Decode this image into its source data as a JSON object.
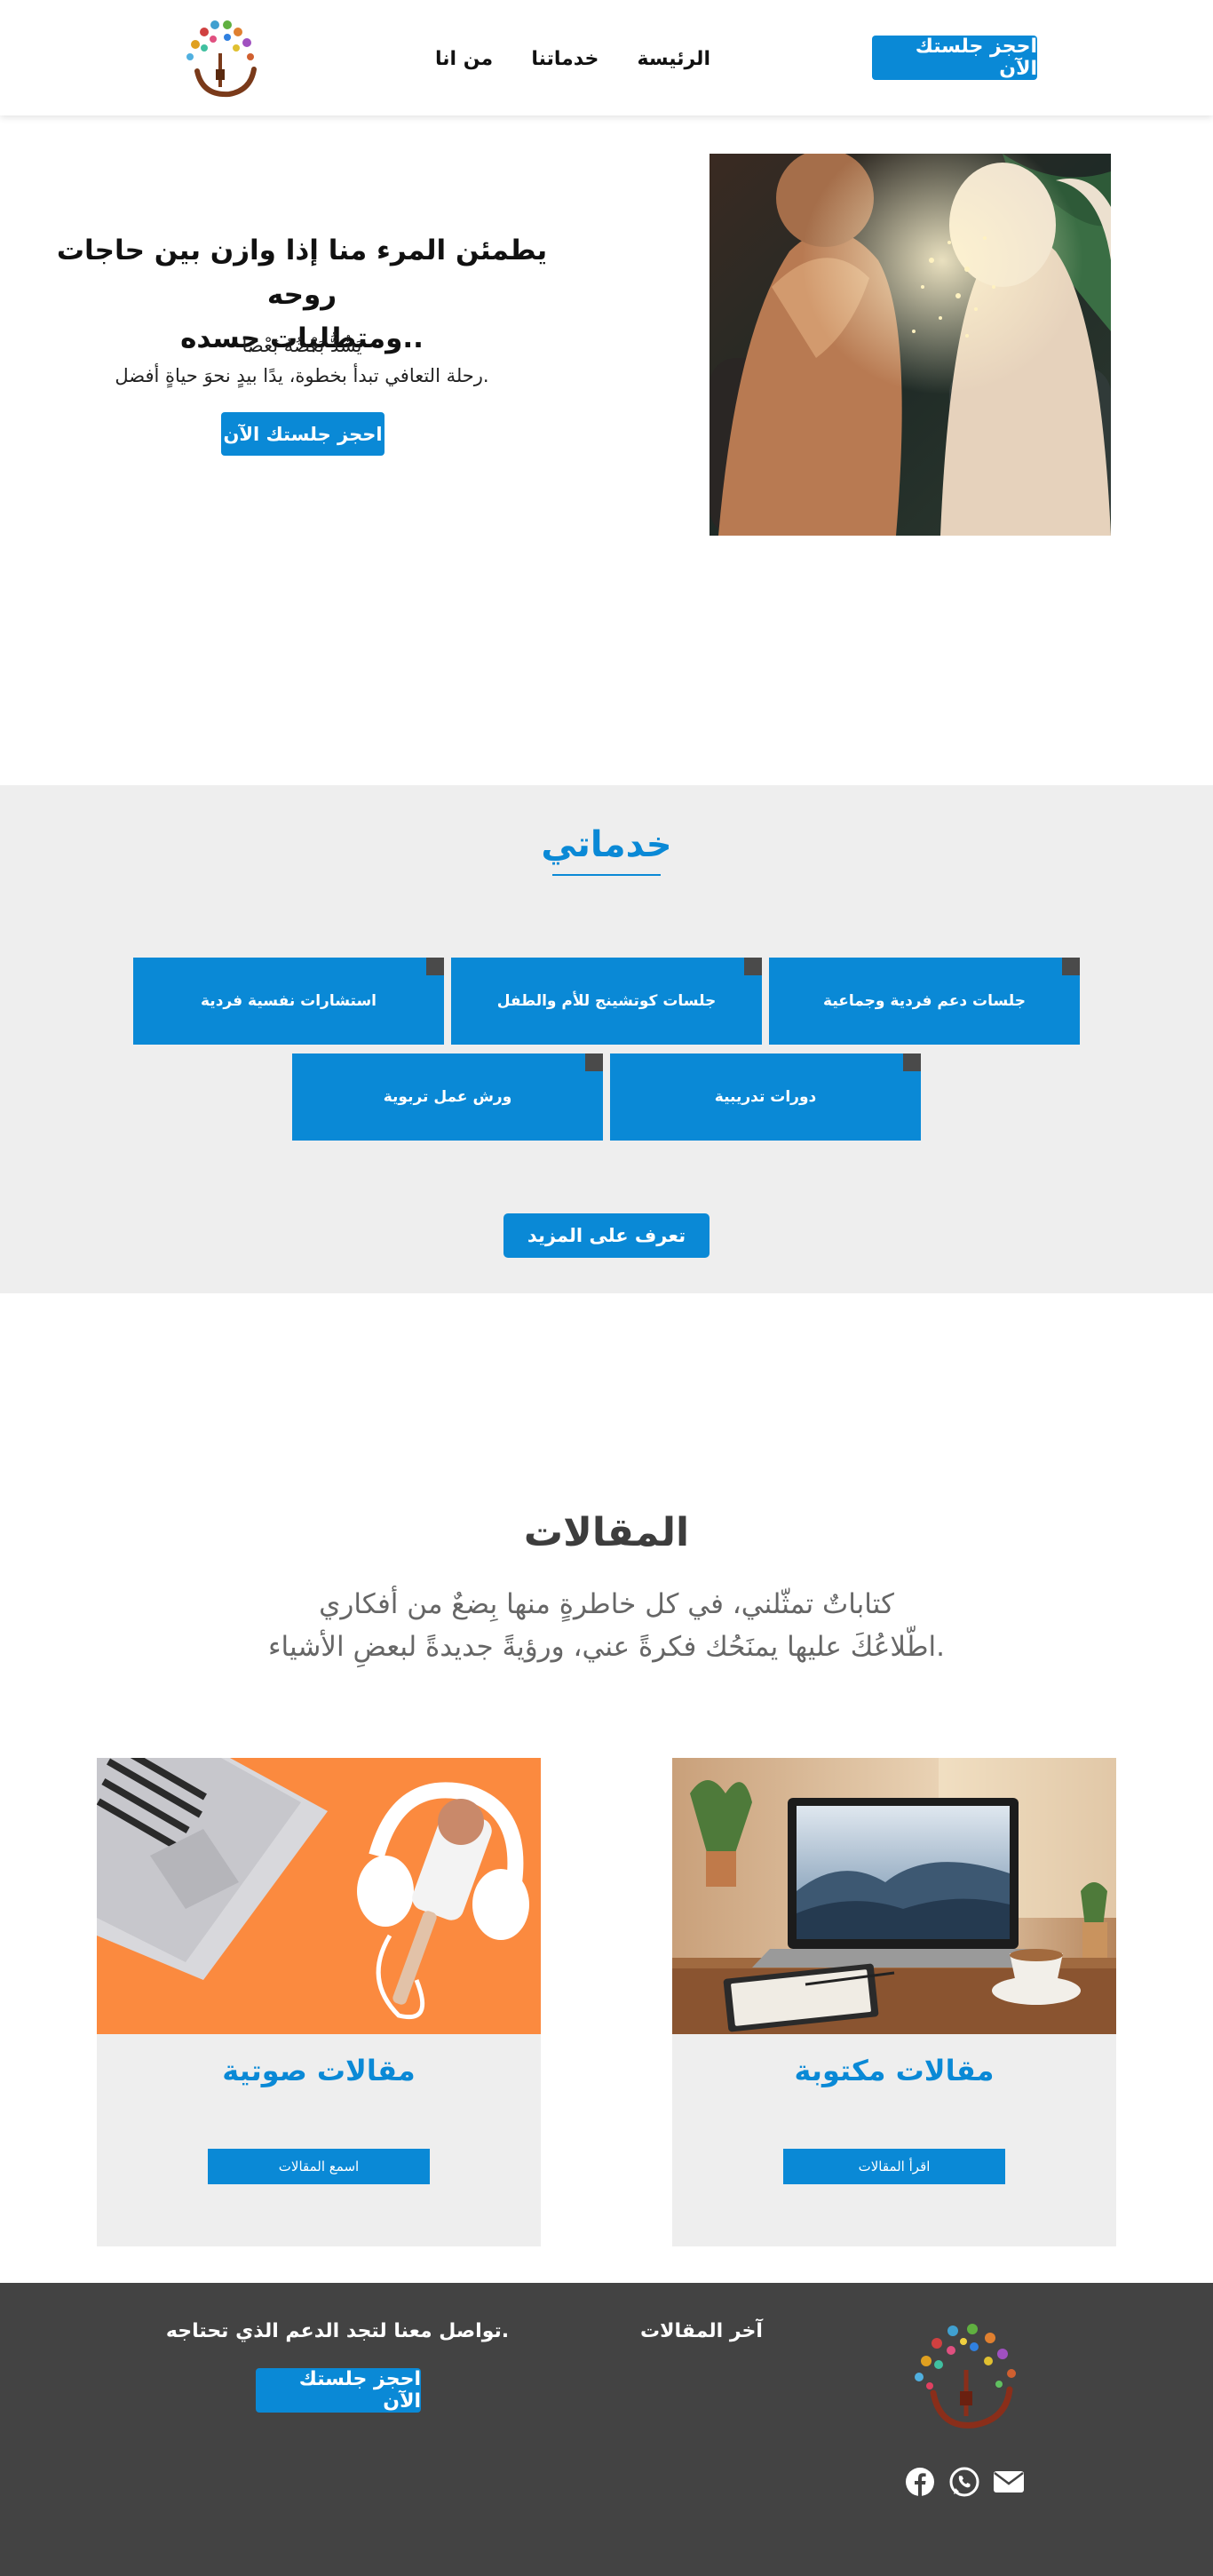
{
  "header": {
    "book_button": "احجز جلستك الآن",
    "nav": [
      "الرئيسة",
      "خدماتنا",
      "من انا"
    ],
    "logo_icon": "tree-logo"
  },
  "hero": {
    "title_line1": "يطمئن المرء منا إذا وازن بين حاجات روحه",
    "title_line2": "..ومتطلبات جسده",
    "subtitle_line1": "يَشُدُّ بَعْضُهُ بَعْضًا",
    "subtitle_line2": ".رحلة التعافي تبدأ بخطوة، يدًا بيدٍ نحوَ حياةٍ أفضل",
    "button": "احجز جلستك الآن",
    "image_icon": "two-women-talking-image"
  },
  "services": {
    "title": "خدماتي",
    "items": [
      "جلسات دعم فردية وجماعية",
      "جلسات كوتشينج للأم والطفل",
      "استشارات نفسية فردية",
      "دورات تدريبية",
      "ورش عمل تربوية"
    ],
    "more_button": "تعرف على المزيد"
  },
  "articles": {
    "title": "المقالات",
    "desc_line1": "كتاباتٌ تمثّلني، في كل خاطرةٍ منها بِضعٌ من أفكاري",
    "desc_line2": ".اطّلاعُكَ عليها يمنَحُك فكرةً عني، ورؤيةً جديدةً لبعضِ الأشياء",
    "cards": [
      {
        "title": "مقالات مكتوبة",
        "button": "اقرأ المقالات",
        "image_icon": "laptop-notebook-coffee-image"
      },
      {
        "title": "مقالات صوتية",
        "button": "اسمع المقالات",
        "image_icon": "headphones-microphone-image"
      }
    ]
  },
  "footer": {
    "latest_articles": "آخر المقالات",
    "contact": ".تواصل معنا لتجد الدعم الذي تحتاجه",
    "button": "احجز جلستك الآن",
    "socials": [
      "facebook-icon",
      "whatsapp-icon",
      "email-icon"
    ]
  },
  "colors": {
    "accent": "#0a89d6",
    "services_bg": "#eeeeee",
    "footer_bg": "#434343",
    "corner": "#4a4a4a"
  }
}
